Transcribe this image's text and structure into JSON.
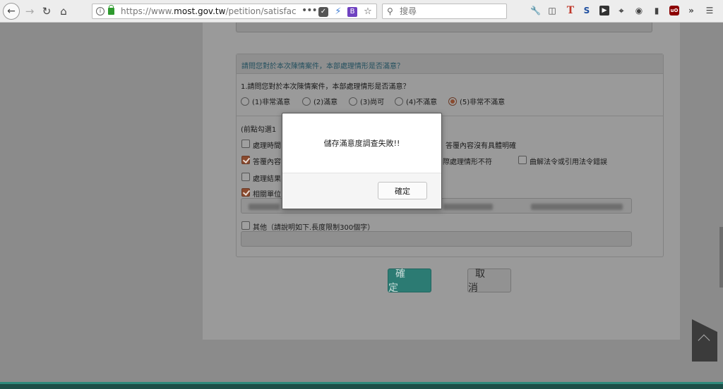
{
  "browser": {
    "url_prefix": "https://www.",
    "url_host": "most.gov.tw",
    "url_path": "/petition/satisfac",
    "search_placeholder": "搜尋",
    "reader_badge": "B",
    "ext_t": "T",
    "ext_s": "S",
    "ext_ub": "uO"
  },
  "form": {
    "section_title": "請問您對於本次陳情案件，本部處理情形是否滿意？",
    "question": "1.請問您對於本次陳情案件，本部處理情形是否滿意？",
    "options": [
      "(1)非常滿意",
      "(2)滿意",
      "(3)尚可",
      "(4)不滿意",
      "(5)非常不滿意"
    ],
    "selected_option": "(5)非常不滿意",
    "reasons_heading": "(前點勾選1",
    "check_items": {
      "item1_left": "處理時間",
      "item1_right": "答覆內容沒有具體明確",
      "item2_left": "答覆內容",
      "item2_mid": "際處理情形不符",
      "item2_right": "曲解法令或引用法令錯誤",
      "item3_left": "處理結果",
      "item4_left": "相關單位"
    },
    "other_label": "其他（請說明如下.長度限制300個字）",
    "confirm_label": "確定",
    "cancel_label": "取消"
  },
  "modal": {
    "message": "儲存滿意度調查失敗!!",
    "ok_label": "確定"
  },
  "colors": {
    "confirm_button": "#2c7b73",
    "radio_selected": "#8a4a2e",
    "footer": "#1d4f48"
  }
}
